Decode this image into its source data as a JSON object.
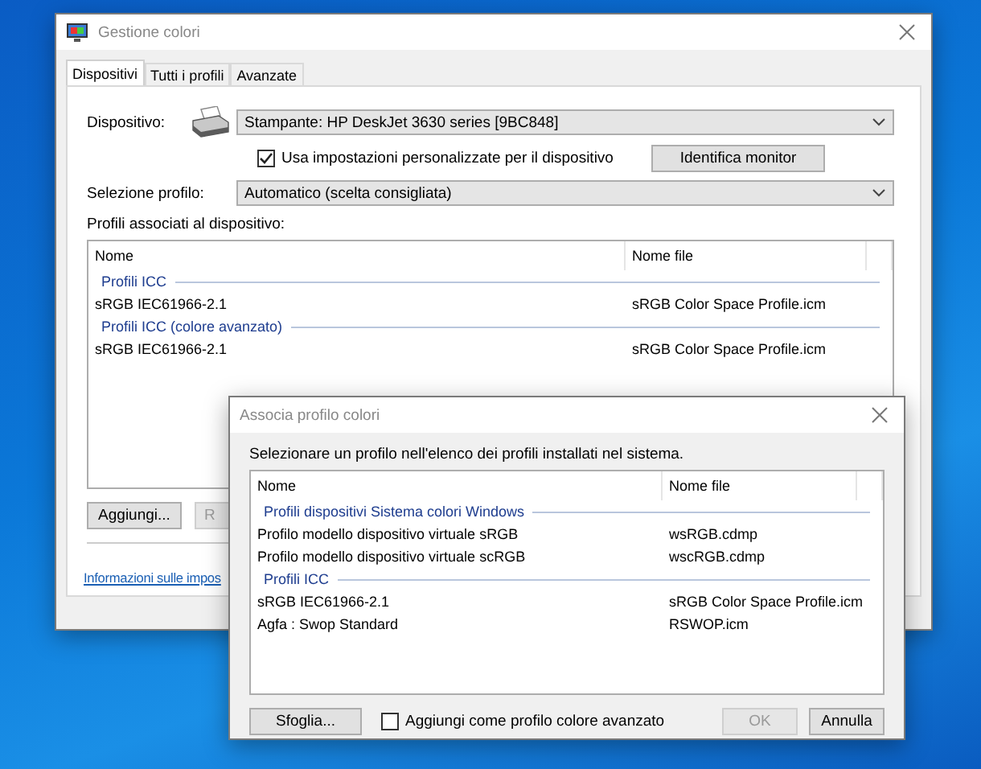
{
  "main_window": {
    "title": "Gestione colori",
    "tabs": [
      {
        "label": "Dispositivi",
        "selected": true
      },
      {
        "label": "Tutti i profili",
        "selected": false
      },
      {
        "label": "Avanzate",
        "selected": false
      }
    ],
    "device": {
      "label": "Dispositivo:",
      "value": "Stampante: HP DeskJet 3630 series [9BC848]"
    },
    "custom_settings": {
      "label": "Usa impostazioni personalizzate per il dispositivo",
      "checked": true
    },
    "identify_button": "Identifica monitor",
    "profile_selection": {
      "label": "Selezione profilo:",
      "value": "Automatico (scelta consigliata)"
    },
    "associated_label": "Profili associati al dispositivo:",
    "profile_list": {
      "columns": [
        "Nome",
        "Nome file"
      ],
      "groups": [
        {
          "name": "Profili ICC",
          "rows": [
            {
              "name": "sRGB IEC61966-2.1",
              "file": "sRGB Color Space Profile.icm"
            }
          ]
        },
        {
          "name": "Profili ICC (colore avanzato)",
          "rows": [
            {
              "name": "sRGB IEC61966-2.1",
              "file": "sRGB Color Space Profile.icm"
            }
          ]
        }
      ]
    },
    "buttons": [
      {
        "label": "Aggiungi...",
        "disabled": false
      },
      {
        "label": "R",
        "disabled": true
      }
    ],
    "link": "Informazioni sulle impos"
  },
  "dialog": {
    "title": "Associa profilo colori",
    "instruction": "Selezionare un profilo nell'elenco dei profili installati nel sistema.",
    "profile_list": {
      "columns": [
        "Nome",
        "Nome file"
      ],
      "groups": [
        {
          "name": "Profili dispositivi Sistema colori Windows",
          "rows": [
            {
              "name": "Profilo modello dispositivo virtuale sRGB",
              "file": "wsRGB.cdmp"
            },
            {
              "name": "Profilo modello dispositivo virtuale scRGB",
              "file": "wscRGB.cdmp"
            }
          ]
        },
        {
          "name": "Profili ICC",
          "rows": [
            {
              "name": "sRGB IEC61966-2.1",
              "file": "sRGB Color Space Profile.icm"
            },
            {
              "name": "Agfa : Swop Standard",
              "file": "RSWOP.icm"
            }
          ]
        }
      ]
    },
    "browse_button": "Sfoglia...",
    "advanced_option": {
      "label": "Aggiungi come profilo colore avanzato",
      "checked": false
    },
    "buttons": [
      {
        "label": "OK",
        "disabled": true
      },
      {
        "label": "Annulla",
        "disabled": false
      }
    ]
  }
}
